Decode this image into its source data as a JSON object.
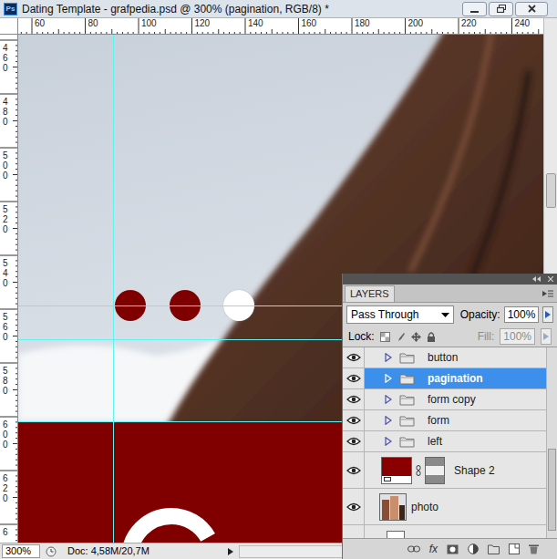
{
  "window": {
    "app_icon": "Ps",
    "title": "Dating Template - grafpedia.psd @ 300% (pagination, RGB/8) *"
  },
  "ruler_h": [
    "60",
    "80",
    "100",
    "120",
    "140",
    "160",
    "180",
    "200",
    "220",
    "240"
  ],
  "ruler_v": [
    "460",
    "480",
    "500",
    "520",
    "540",
    "560",
    "580",
    "600",
    "620",
    "6"
  ],
  "canvas": {
    "pagination_dots": [
      {
        "color": "#7f0000",
        "selected": false
      },
      {
        "color": "#7f0000",
        "selected": false
      },
      {
        "color": "#ffffff",
        "selected": true
      }
    ]
  },
  "layers_panel": {
    "tab": "LAYERS",
    "blend_mode": "Pass Through",
    "opacity_label": "Opacity:",
    "opacity": "100%",
    "lock_label": "Lock:",
    "fill_label": "Fill:",
    "fill": "100%",
    "fill_disabled": true,
    "layers": [
      {
        "name": "button",
        "kind": "group",
        "visible": true,
        "selected": false,
        "expanded": false
      },
      {
        "name": "pagination",
        "kind": "group",
        "visible": true,
        "selected": true,
        "expanded": false
      },
      {
        "name": "form copy",
        "kind": "group",
        "visible": true,
        "selected": false,
        "expanded": false
      },
      {
        "name": "form",
        "kind": "group",
        "visible": true,
        "selected": false,
        "expanded": false
      },
      {
        "name": "left",
        "kind": "group",
        "visible": true,
        "selected": false,
        "expanded": false
      },
      {
        "name": "Shape 2",
        "kind": "shape",
        "visible": true,
        "selected": false,
        "expanded": false
      },
      {
        "name": "photo",
        "kind": "image",
        "visible": true,
        "selected": false,
        "expanded": false
      },
      {
        "name": "",
        "kind": "partial",
        "visible": false,
        "selected": false,
        "expanded": false
      }
    ],
    "toolbar_fx": "fx"
  },
  "status_bar": {
    "zoom": "300%",
    "doc": "Doc: 4,58M/20,7M"
  }
}
